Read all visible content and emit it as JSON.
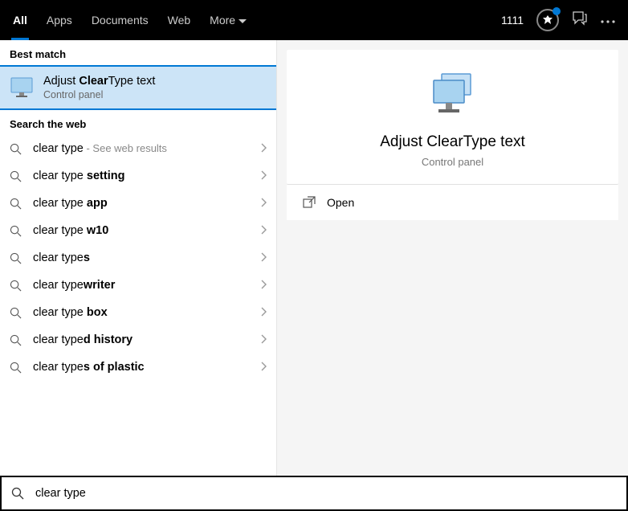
{
  "tabs": {
    "all": "All",
    "apps": "Apps",
    "documents": "Documents",
    "web": "Web",
    "more": "More"
  },
  "topbar": {
    "points": "1111"
  },
  "sections": {
    "best_match": "Best match",
    "search_web": "Search the web"
  },
  "best_match": {
    "title_prefix": "Adjust ",
    "title_bold": "Clear",
    "title_suffix": "Type text",
    "subtitle": "Control panel"
  },
  "web_results": [
    {
      "prefix": "clear type",
      "bold": "",
      "suffix": " - See web results",
      "type": "first"
    },
    {
      "prefix": "clear type ",
      "bold": "setting",
      "suffix": ""
    },
    {
      "prefix": "clear type ",
      "bold": "app",
      "suffix": ""
    },
    {
      "prefix": "clear type ",
      "bold": "w10",
      "suffix": ""
    },
    {
      "prefix": "clear type",
      "bold": "s",
      "suffix": ""
    },
    {
      "prefix": "clear type",
      "bold": "writer",
      "suffix": ""
    },
    {
      "prefix": "clear type ",
      "bold": "box",
      "suffix": ""
    },
    {
      "prefix": "clear type",
      "bold": "d history",
      "suffix": ""
    },
    {
      "prefix": "clear type",
      "bold": "s of plastic",
      "suffix": ""
    }
  ],
  "preview": {
    "title": "Adjust ClearType text",
    "subtitle": "Control panel",
    "action_open": "Open"
  },
  "search": {
    "query": "clear type"
  }
}
